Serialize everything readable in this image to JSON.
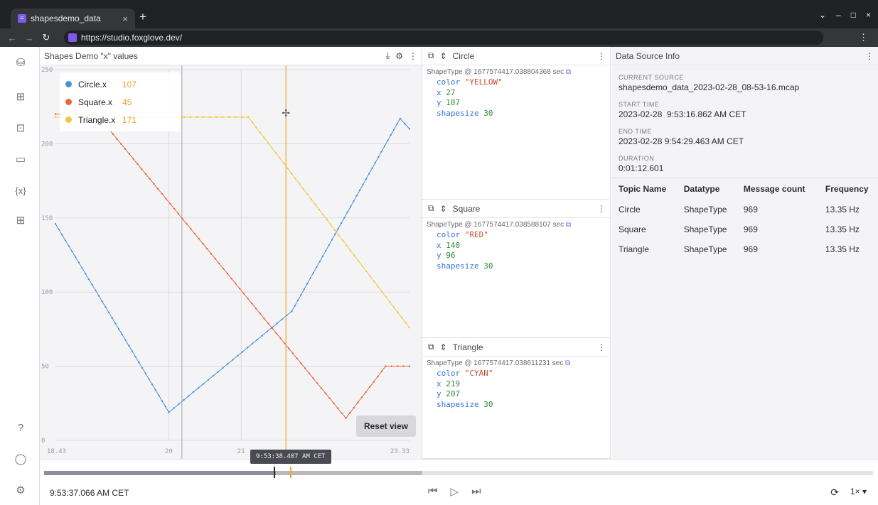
{
  "browser": {
    "tab_title": "shapesdemo_data",
    "tab_close": "×",
    "new_tab": "+",
    "url": "https://studio.foxglove.dev/",
    "window_controls": [
      "⌄",
      "–",
      "□",
      "×"
    ]
  },
  "rail": {
    "icons": [
      "data-source-icon",
      "layout-icon",
      "add-panel-icon",
      "panel-settings-icon",
      "variables-icon",
      "extensions-icon",
      "help-icon",
      "account-icon",
      "settings-icon"
    ]
  },
  "plot": {
    "title": "Shapes Demo \"x\" values",
    "reset_label": "Reset view",
    "legend": [
      {
        "name": "Circle.x",
        "value": "107",
        "color": "#4a90d9"
      },
      {
        "name": "Square.x",
        "value": "45",
        "color": "#e8663a"
      },
      {
        "name": "Triangle.x",
        "value": "171",
        "color": "#f2c740"
      }
    ],
    "y_ticks": [
      "250",
      "200",
      "150",
      "100",
      "50",
      "0"
    ],
    "x_ticks": [
      "18.43",
      "20",
      "21",
      "23.33"
    ],
    "hover_color": "#e8a92b"
  },
  "chart_data": {
    "type": "line",
    "title": "Shapes Demo \"x\" values",
    "xlabel": "",
    "ylabel": "",
    "xlim": [
      18.43,
      23.33
    ],
    "ylim": [
      0,
      250
    ],
    "series": [
      {
        "name": "Circle.x",
        "color": "#4a90d9",
        "points": [
          [
            18.43,
            146
          ],
          [
            20.0,
            19
          ],
          [
            21.7,
            87
          ],
          [
            23.2,
            217
          ],
          [
            23.33,
            210
          ]
        ]
      },
      {
        "name": "Square.x",
        "color": "#e8663a",
        "points": [
          [
            18.43,
            220
          ],
          [
            19.0,
            220
          ],
          [
            22.45,
            15
          ],
          [
            23.0,
            50
          ],
          [
            23.33,
            50
          ]
        ]
      },
      {
        "name": "Triangle.x",
        "color": "#f2c740",
        "points": [
          [
            18.43,
            218
          ],
          [
            21.1,
            218
          ],
          [
            23.33,
            76
          ]
        ]
      }
    ],
    "cursor_x": 21.62,
    "reference_x": 20.18,
    "legend_position": "top-left"
  },
  "messages": [
    {
      "title": "Circle",
      "meta": "ShapeType @ 1677574417.038804368 sec",
      "fields": [
        {
          "key": "color",
          "value": "\"YELLOW\"",
          "kind": "s"
        },
        {
          "key": "x",
          "value": "27",
          "kind": "n"
        },
        {
          "key": "y",
          "value": "107",
          "kind": "n"
        },
        {
          "key": "shapesize",
          "value": "30",
          "kind": "n"
        }
      ]
    },
    {
      "title": "Square",
      "meta": "ShapeType @ 1677574417.038588107 sec",
      "fields": [
        {
          "key": "color",
          "value": "\"RED\"",
          "kind": "s"
        },
        {
          "key": "x",
          "value": "140",
          "kind": "n"
        },
        {
          "key": "y",
          "value": "96",
          "kind": "n"
        },
        {
          "key": "shapesize",
          "value": "30",
          "kind": "n"
        }
      ]
    },
    {
      "title": "Triangle",
      "meta": "ShapeType @ 1677574417.038611231 sec",
      "fields": [
        {
          "key": "color",
          "value": "\"CYAN\"",
          "kind": "s"
        },
        {
          "key": "x",
          "value": "219",
          "kind": "n"
        },
        {
          "key": "y",
          "value": "207",
          "kind": "n"
        },
        {
          "key": "shapesize",
          "value": "30",
          "kind": "n"
        }
      ]
    }
  ],
  "info": {
    "title": "Data Source Info",
    "current_source_label": "CURRENT SOURCE",
    "current_source": "shapesdemo_data_2023-02-28_08-53-16.mcap",
    "start_time_label": "START TIME",
    "start_time": "2023-02-28  9:53:16.862 AM CET",
    "end_time_label": "END TIME",
    "end_time": "2023-02-28 9:54:29.463 AM CET",
    "duration_label": "DURATION",
    "duration": "0:01:12.601",
    "columns": [
      "Topic Name",
      "Datatype",
      "Message count",
      "Frequency"
    ],
    "rows": [
      [
        "Circle",
        "ShapeType",
        "969",
        "13.35 Hz"
      ],
      [
        "Square",
        "ShapeType",
        "969",
        "13.35 Hz"
      ],
      [
        "Triangle",
        "ShapeType",
        "969",
        "13.35 Hz"
      ]
    ]
  },
  "playback": {
    "current_time": "9:53:37.066 AM CET",
    "tooltip_time": "9:53:38.407 AM CET",
    "speed": "1×",
    "played_fraction": 0.28,
    "loaded_fraction": 0.456
  }
}
